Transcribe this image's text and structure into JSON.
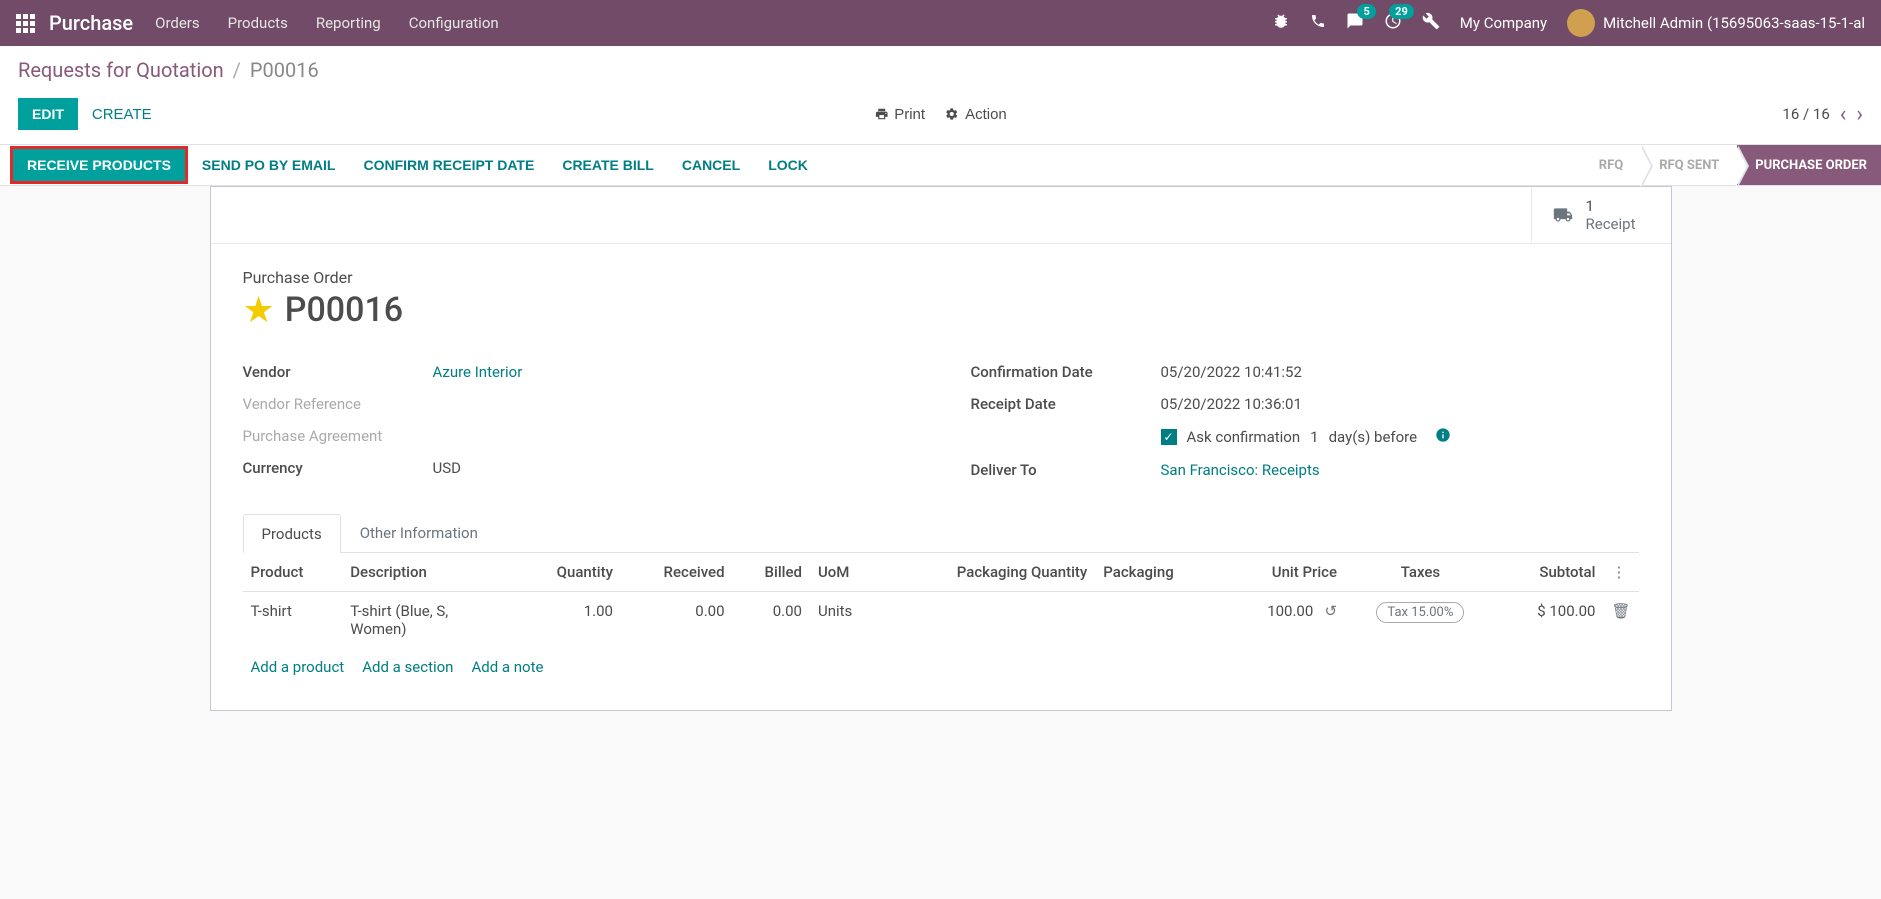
{
  "nav": {
    "app_title": "Purchase",
    "links": [
      "Orders",
      "Products",
      "Reporting",
      "Configuration"
    ],
    "msg_badge": "5",
    "activity_badge": "29",
    "company": "My Company",
    "user": "Mitchell Admin (15695063-saas-15-1-al"
  },
  "breadcrumb": {
    "link": "Requests for Quotation",
    "current": "P00016"
  },
  "controls": {
    "edit": "EDIT",
    "create": "CREATE",
    "print": "Print",
    "action": "Action",
    "pager": "16 / 16"
  },
  "status_actions": [
    "RECEIVE PRODUCTS",
    "SEND PO BY EMAIL",
    "CONFIRM RECEIPT DATE",
    "CREATE BILL",
    "CANCEL",
    "LOCK"
  ],
  "status_steps": [
    "RFQ",
    "RFQ SENT",
    "PURCHASE ORDER"
  ],
  "stat_button": {
    "count": "1",
    "label": "Receipt"
  },
  "doc": {
    "label": "Purchase Order",
    "name": "P00016",
    "vendor_lbl": "Vendor",
    "vendor": "Azure Interior",
    "vendor_ref_lbl": "Vendor Reference",
    "purchase_agreement_lbl": "Purchase Agreement",
    "currency_lbl": "Currency",
    "currency": "USD",
    "confirm_date_lbl": "Confirmation Date",
    "confirm_date": "05/20/2022 10:41:52",
    "receipt_date_lbl": "Receipt Date",
    "receipt_date": "05/20/2022 10:36:01",
    "ask_confirm_prefix": "Ask confirmation",
    "ask_confirm_days": "1",
    "ask_confirm_suffix": "day(s) before",
    "deliver_to_lbl": "Deliver To",
    "deliver_to": "San Francisco: Receipts"
  },
  "tabs": [
    "Products",
    "Other Information"
  ],
  "table": {
    "headers": {
      "product": "Product",
      "description": "Description",
      "quantity": "Quantity",
      "received": "Received",
      "billed": "Billed",
      "uom": "UoM",
      "pkg_qty": "Packaging Quantity",
      "packaging": "Packaging",
      "unit_price": "Unit Price",
      "taxes": "Taxes",
      "subtotal": "Subtotal"
    },
    "row": {
      "product": "T-shirt",
      "description": "T-shirt (Blue, S, Women)",
      "quantity": "1.00",
      "received": "0.00",
      "billed": "0.00",
      "uom": "Units",
      "pkg_qty": "",
      "packaging": "",
      "unit_price": "100.00",
      "taxes": "Tax 15.00%",
      "subtotal": "$ 100.00"
    },
    "add_product": "Add a product",
    "add_section": "Add a section",
    "add_note": "Add a note"
  }
}
